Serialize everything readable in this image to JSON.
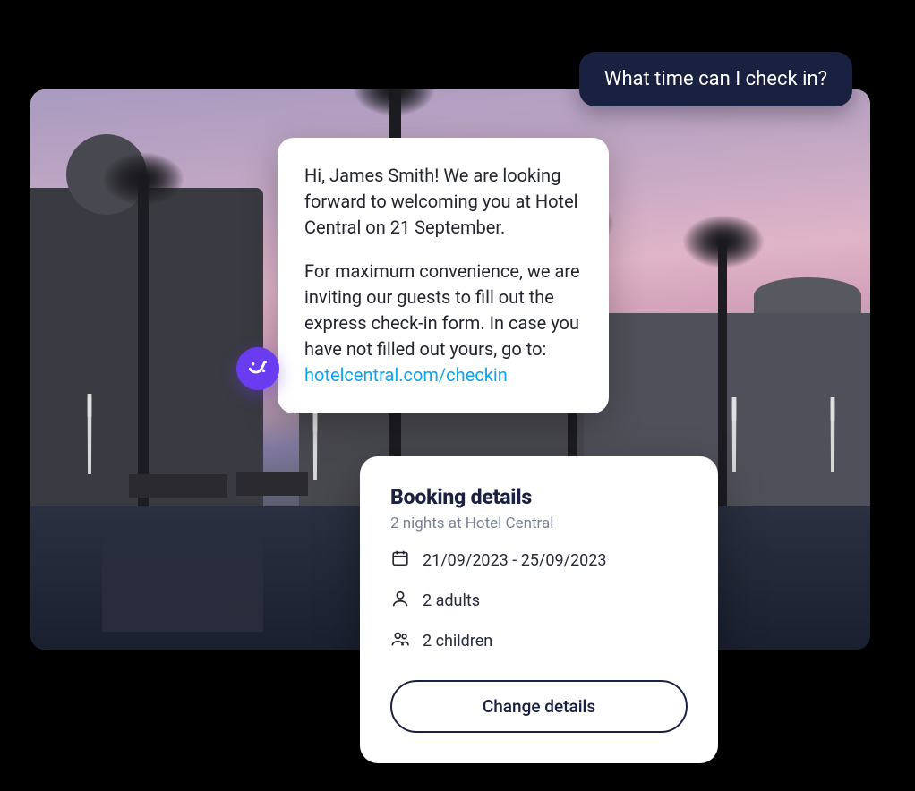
{
  "user_message": "What time can I check in?",
  "assistant": {
    "paragraph1": "Hi, James Smith! We are looking forward to welcoming you at Hotel Central on 21 September.",
    "paragraph2_prefix": "For maximum convenience, we are inviting our guests to fill out the express check-in form. In case you have not filled out yours, go to: ",
    "link_text": "hotelcentral.com/checkin"
  },
  "booking": {
    "title": "Booking details",
    "subtitle": "2 nights at Hotel Central",
    "dates": "21/09/2023 - 25/09/2023",
    "adults": "2 adults",
    "children": "2 children",
    "change_button": "Change details"
  }
}
